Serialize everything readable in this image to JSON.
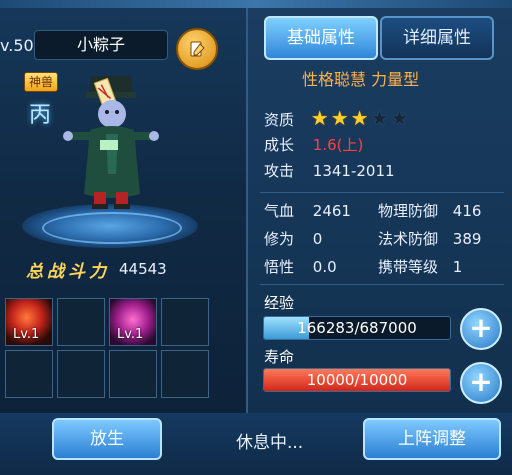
{
  "pet": {
    "level_text": "v.50",
    "name": "小粽子",
    "badge": "神兽",
    "element": "丙",
    "power_label": "总战斗力",
    "power_value": "44543"
  },
  "skills": [
    {
      "lv": "Lv.1",
      "type": "fire"
    },
    {
      "lv": "",
      "type": "empty"
    },
    {
      "lv": "Lv.1",
      "type": "magic"
    },
    {
      "lv": "",
      "type": "empty"
    },
    {
      "lv": "",
      "type": "empty"
    },
    {
      "lv": "",
      "type": "empty"
    },
    {
      "lv": "",
      "type": "empty"
    },
    {
      "lv": "",
      "type": "empty"
    }
  ],
  "tabs": {
    "basic": "基础属性",
    "detail": "详细属性"
  },
  "traits": "性格聪慧 力量型",
  "attrs": {
    "quality_label": "资质",
    "quality_stars": 3,
    "quality_max": 5,
    "growth_label": "成长",
    "growth_value": "1.6(上)",
    "attack_label": "攻击",
    "attack_value": "1341-2011",
    "hp_label": "气血",
    "hp_value": "2461",
    "pdef_label": "物理防御",
    "pdef_value": "416",
    "cult_label": "修为",
    "cult_value": "0",
    "mdef_label": "法术防御",
    "mdef_value": "389",
    "savvy_label": "悟性",
    "savvy_value": "0.0",
    "carry_label": "携带等级",
    "carry_value": "1"
  },
  "exp": {
    "label": "经验",
    "current": 166283,
    "max": 687000,
    "text": "166283/687000"
  },
  "life": {
    "label": "寿命",
    "current": 10000,
    "max": 10000,
    "text": "10000/10000"
  },
  "buttons": {
    "release": "放生",
    "deploy": "上阵调整"
  },
  "status": "休息中...",
  "colors": {
    "accent": "#2e86d8",
    "trait": "#ffb24a",
    "growth": "#ff4040",
    "star": "#ffcf2e",
    "exp": "#3b9ad6",
    "life": "#d1271a"
  }
}
